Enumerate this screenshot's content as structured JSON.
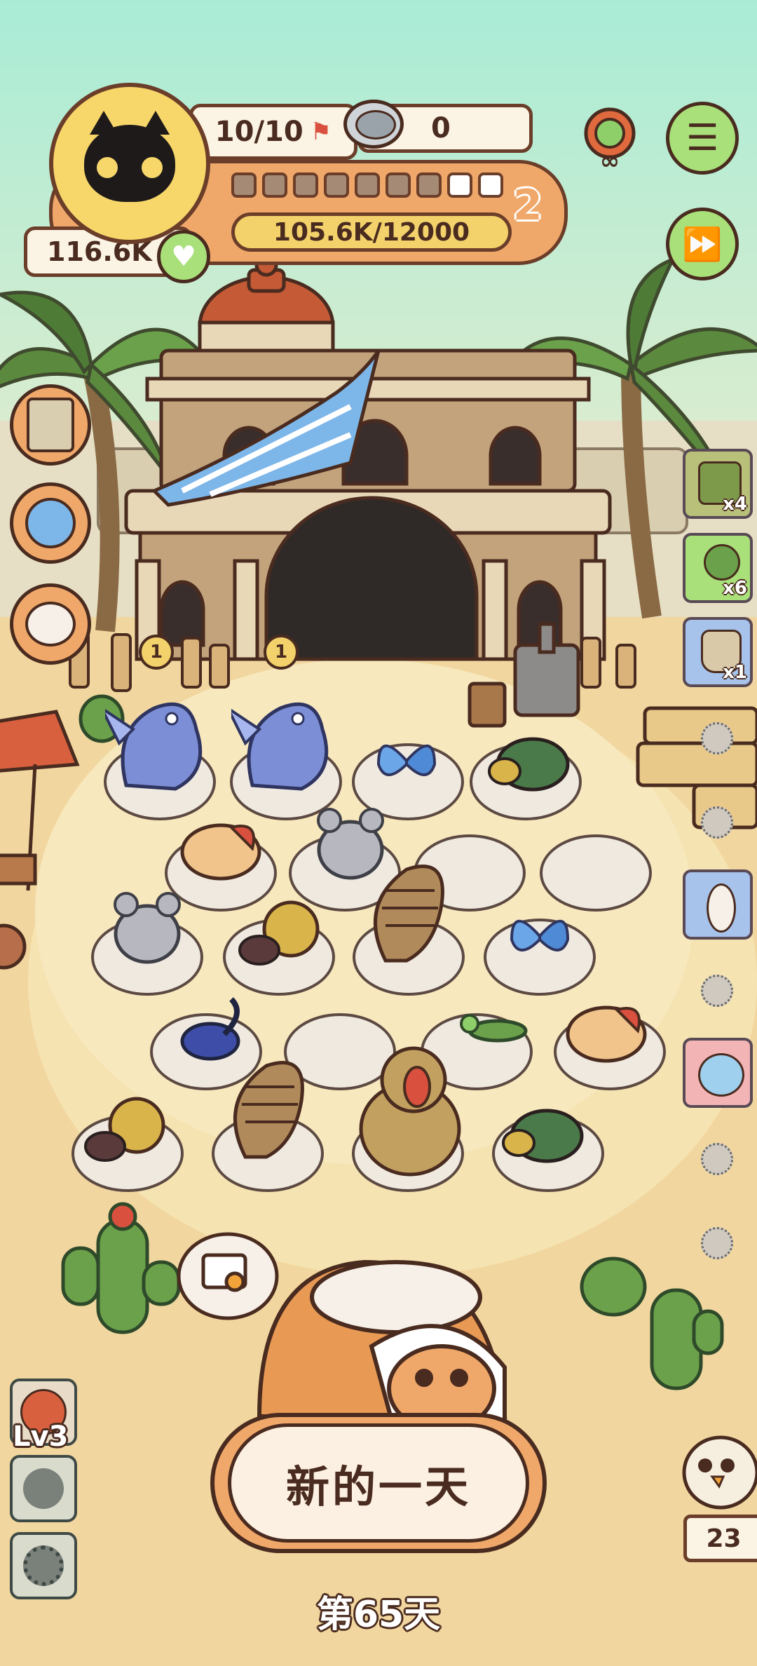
{
  "header": {
    "capacity": "10/10",
    "cans_count": "0",
    "coins": "116.6K",
    "level_number": "2",
    "progress_text": "105.6K/12000",
    "pips_filled": 7,
    "pips_total": 9
  },
  "side_items": [
    {
      "name": "paw-card",
      "count": "x4"
    },
    {
      "name": "lollipop",
      "count": "x6"
    },
    {
      "name": "seed-bag",
      "count": "x1"
    }
  ],
  "coin_badges": [
    "1",
    "1"
  ],
  "bottom": {
    "skill_level": "Lv3",
    "new_day_button": "新的一天",
    "day_label": "第65天",
    "chick_count": "23"
  },
  "colors": {
    "sky": "#a9e9d3",
    "sand": "#f1d79f",
    "outline": "#4a2b1f",
    "accent_orange": "#f0a86a",
    "green_btn": "#a9e07a"
  }
}
